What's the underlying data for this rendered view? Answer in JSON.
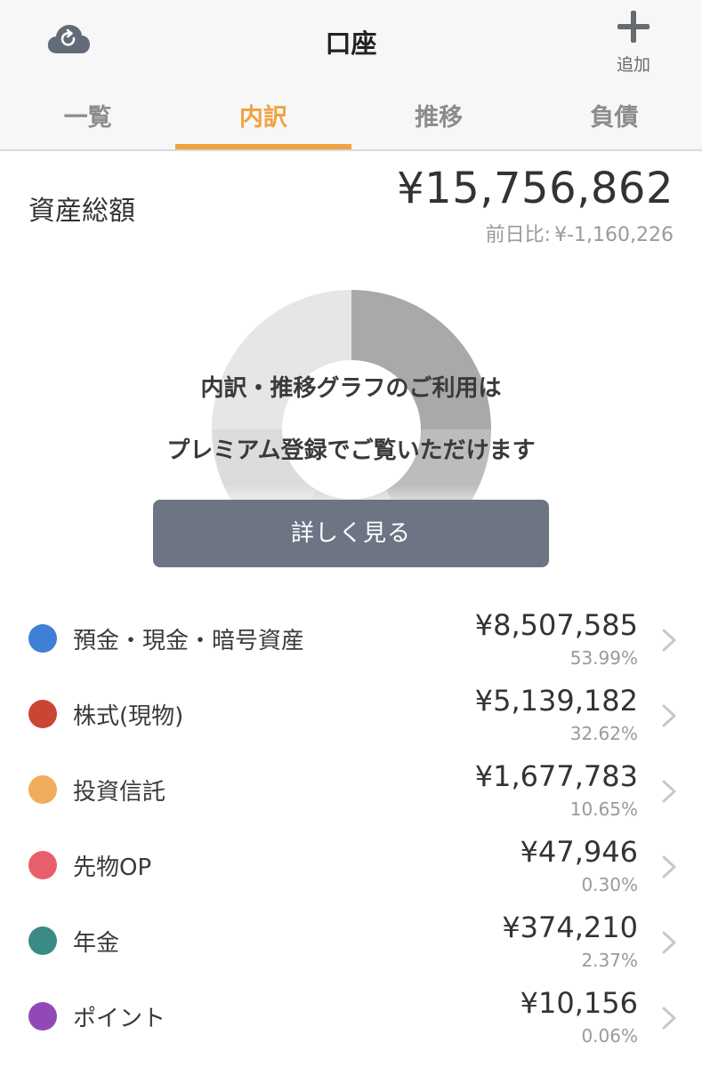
{
  "header": {
    "title": "口座",
    "add_label": "追加",
    "sync_icon": "cloud-sync-icon",
    "add_icon": "plus-icon"
  },
  "tabs": [
    {
      "label": "一覧",
      "active": false
    },
    {
      "label": "内訳",
      "active": true
    },
    {
      "label": "推移",
      "active": false
    },
    {
      "label": "負債",
      "active": false
    }
  ],
  "summary": {
    "label": "資産総額",
    "total": "¥15,756,862",
    "diff_label": "前日比:",
    "diff_value": "¥-1,160,226"
  },
  "premium": {
    "line1": "内訳・推移グラフのご利用は",
    "line2": "プレミアム登録でご覧いただけます",
    "button_label": "詳しく見る"
  },
  "assets": [
    {
      "label": "預金・現金・暗号資産",
      "amount": "¥8,507,585",
      "percent": "53.99%",
      "color": "#3f7fd6"
    },
    {
      "label": "株式(現物)",
      "amount": "¥5,139,182",
      "percent": "32.62%",
      "color": "#cc4433"
    },
    {
      "label": "投資信託",
      "amount": "¥1,677,783",
      "percent": "10.65%",
      "color": "#f0ad5c"
    },
    {
      "label": "先物OP",
      "amount": "¥47,946",
      "percent": "0.30%",
      "color": "#e85f6b"
    },
    {
      "label": "年金",
      "amount": "¥374,210",
      "percent": "2.37%",
      "color": "#3a8a85"
    },
    {
      "label": "ポイント",
      "amount": "¥10,156",
      "percent": "0.06%",
      "color": "#9249b8"
    }
  ],
  "colors": {
    "accent": "#f0a240",
    "button": "#6d7484"
  }
}
